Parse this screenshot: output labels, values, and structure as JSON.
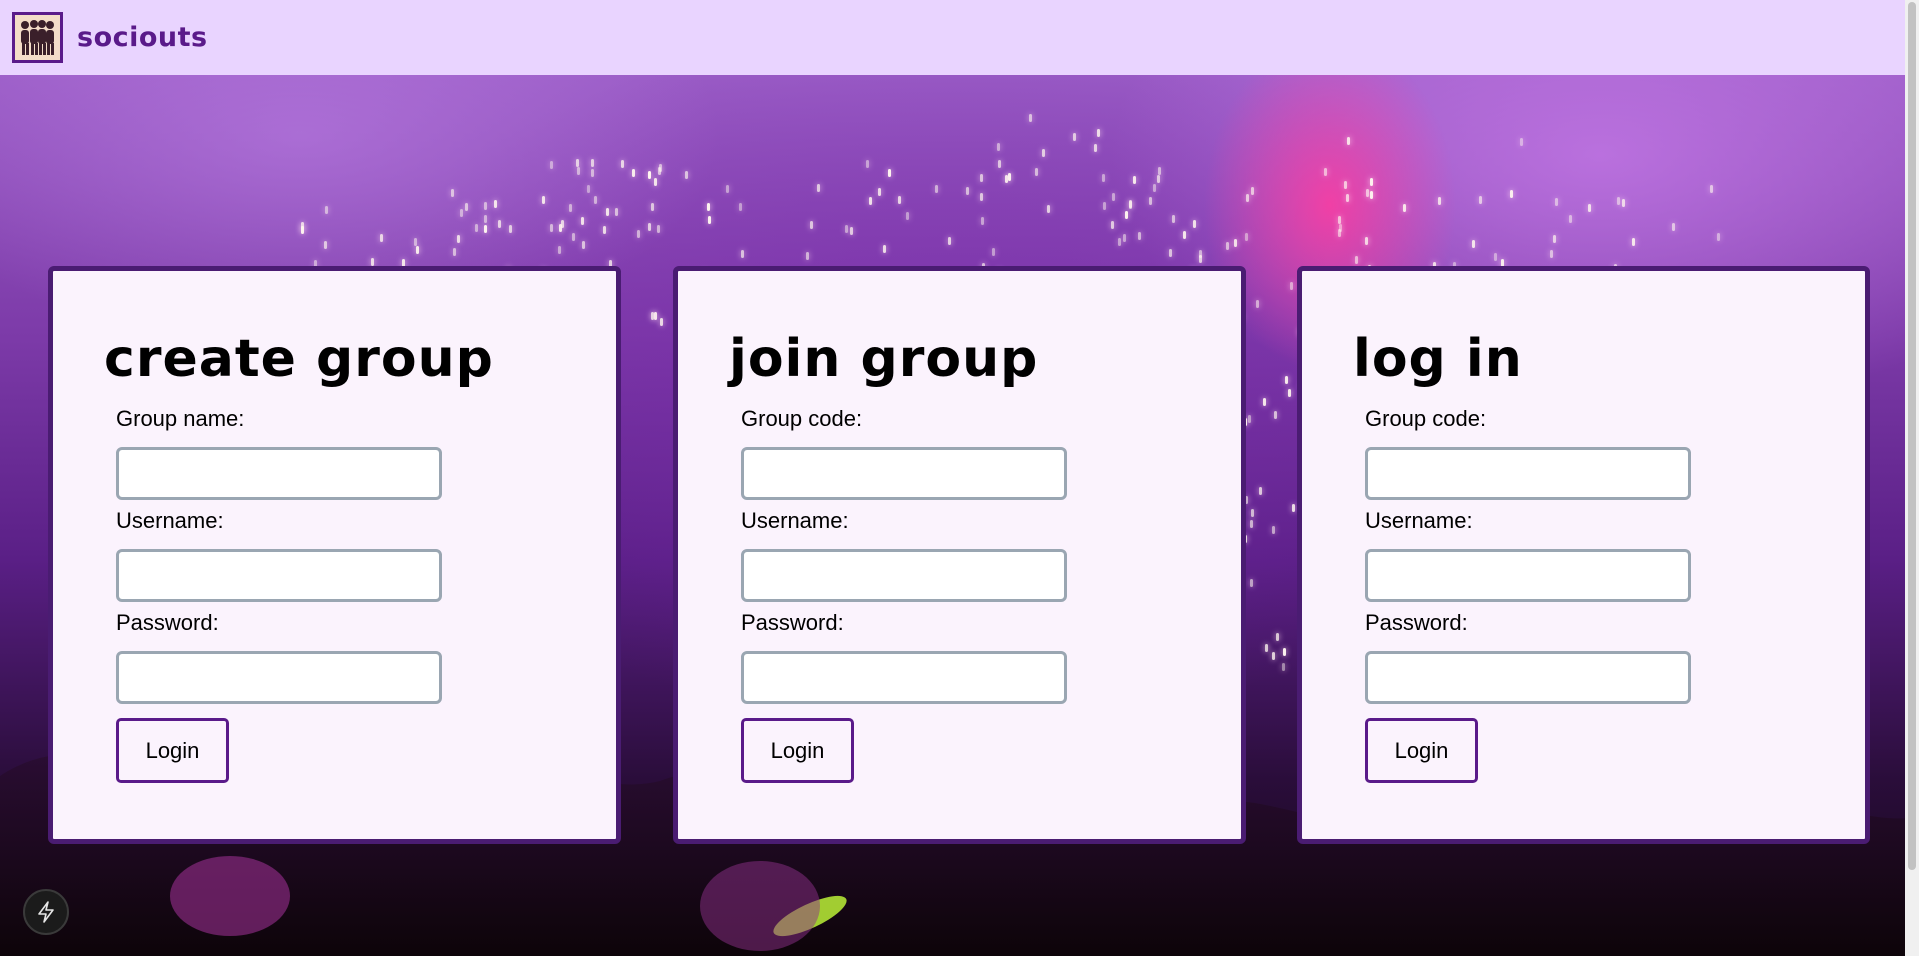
{
  "navbar": {
    "logo_icon": "group-people-icon",
    "brand": "sociouts"
  },
  "cards": [
    {
      "title": "create group",
      "fields": [
        {
          "label": "Group name:",
          "value": ""
        },
        {
          "label": "Username:",
          "value": ""
        },
        {
          "label": "Password:",
          "value": ""
        }
      ],
      "button": "Login"
    },
    {
      "title": "join group",
      "fields": [
        {
          "label": "Group code:",
          "value": ""
        },
        {
          "label": "Username:",
          "value": ""
        },
        {
          "label": "Password:",
          "value": ""
        }
      ],
      "button": "Login"
    },
    {
      "title": "log in",
      "fields": [
        {
          "label": "Group code:",
          "value": ""
        },
        {
          "label": "Username:",
          "value": ""
        },
        {
          "label": "Password:",
          "value": ""
        }
      ],
      "button": "Login"
    }
  ],
  "dev_indicator_icon": "lightning-bolt-icon",
  "colors": {
    "navbar_bg": "#e9d4ff",
    "brand": "#5a1a8a",
    "card_bg": "#fbf3fd",
    "card_border": "#4a1c72",
    "input_border": "#9aa6b2"
  }
}
